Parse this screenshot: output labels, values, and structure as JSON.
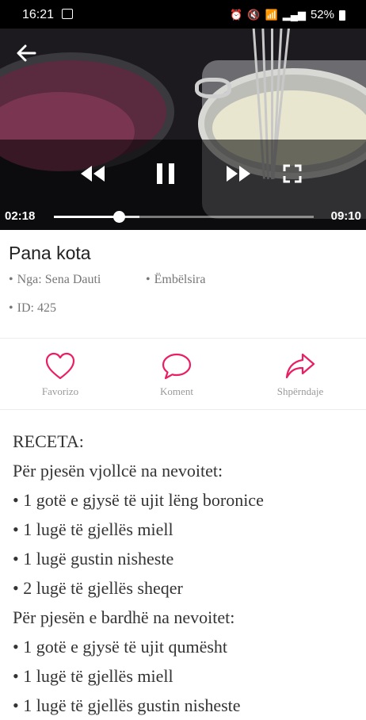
{
  "status_bar": {
    "time": "16:21",
    "battery": "52%"
  },
  "video": {
    "current_time": "02:18",
    "total_time": "09:10",
    "progress_fraction": 0.25,
    "buffered_fraction": 0.33
  },
  "recipe": {
    "title": "Pana kota",
    "author": "Nga: Sena Dauti",
    "category": "Ëmbëlsira",
    "id": "ID: 425"
  },
  "actions": {
    "favorite_label": "Favorizo",
    "comment_label": "Koment",
    "share_label": "Shpërndaje",
    "accent": "#e91e63"
  },
  "body": {
    "lines": [
      "RECETA:",
      "Për pjesën vjollcë na nevoitet:",
      "• 1 gotë e gjysë të ujit lëng boronice",
      "• 1 lugë të gjellës miell",
      "• 1 lugë gustin nisheste",
      "• 2 lugë të gjellës sheqer",
      "Për pjesën e bardhë na nevoitet:",
      "• 1 gotë e gjysë të ujit qumësht",
      "• 1 lugë të gjellës miell",
      "• 1 lugë të gjellës gustin nisheste"
    ]
  }
}
